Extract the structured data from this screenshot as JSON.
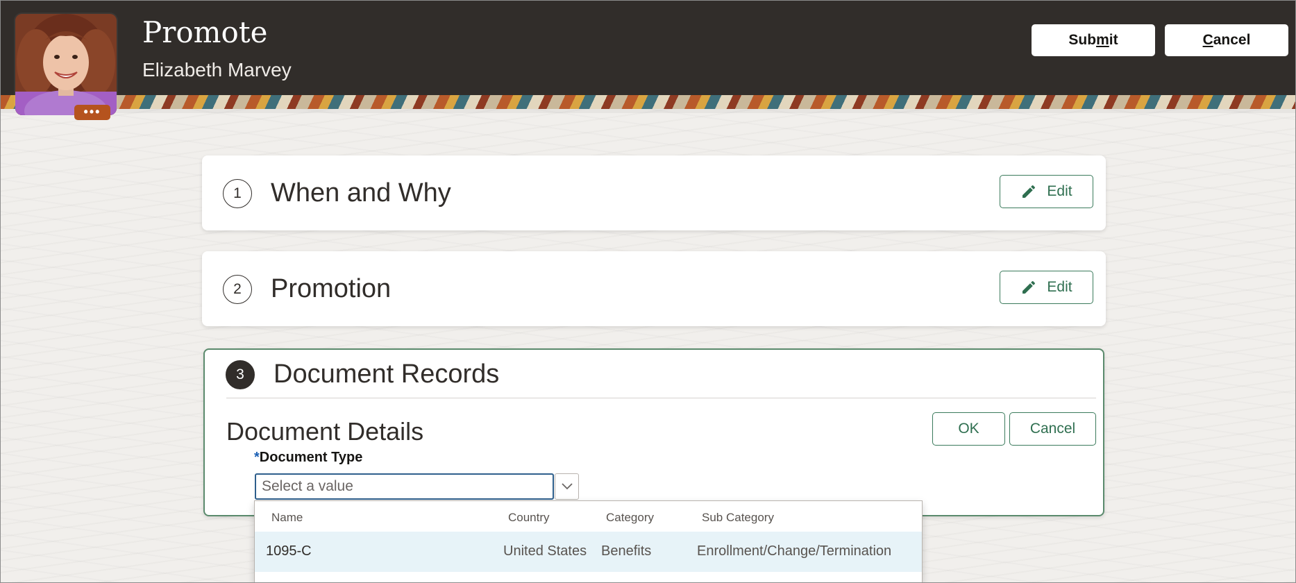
{
  "header": {
    "title": "Promote",
    "subtitle": "Elizabeth Marvey",
    "avatar_menu_label": "•••",
    "submit_pre": "Sub",
    "submit_mnemonic": "m",
    "submit_post": "it",
    "cancel_mnemonic": "C",
    "cancel_post": "ancel"
  },
  "steps": [
    {
      "number": "1",
      "title": "When and Why",
      "edit_label": "Edit"
    },
    {
      "number": "2",
      "title": "Promotion",
      "edit_label": "Edit"
    },
    {
      "number": "3",
      "title": "Document Records"
    }
  ],
  "document_details": {
    "title": "Document Details",
    "ok_label": "OK",
    "cancel_label": "Cancel",
    "required_marker": "*",
    "field_label": "Document Type",
    "placeholder": "Select a value"
  },
  "dropdown": {
    "columns": [
      "Name",
      "Country",
      "Category",
      "Sub Category"
    ],
    "rows": [
      {
        "name": "1095-C",
        "country": "United States",
        "category": "Benefits",
        "sub_category": "Enrollment/Change/Termination"
      }
    ]
  },
  "colors": {
    "header_bg": "#312d2a",
    "accent_green": "#2f6f50",
    "focus_blue": "#2e5f8c",
    "menu_orange": "#b5531e",
    "row_highlight": "#e7f3f8"
  },
  "icons": {
    "edit": "pencil-icon",
    "dropdown": "chevron-down-icon",
    "avatar_menu": "more-icon"
  }
}
